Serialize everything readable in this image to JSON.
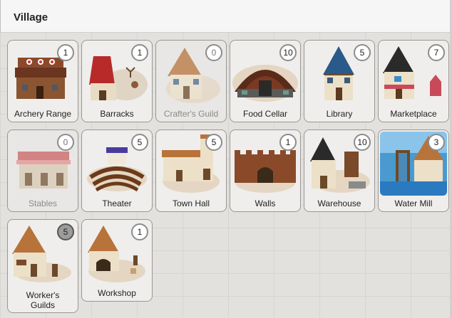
{
  "header": {
    "title": "Village"
  },
  "buildings": [
    {
      "name": "Archery Range",
      "count": "1"
    },
    {
      "name": "Barracks",
      "count": "1"
    },
    {
      "name": "Crafter's Guild",
      "count": "0"
    },
    {
      "name": "Food Cellar",
      "count": "10"
    },
    {
      "name": "Library",
      "count": "5"
    },
    {
      "name": "Marketplace",
      "count": "7"
    },
    {
      "name": "Stables",
      "count": "0"
    },
    {
      "name": "Theater",
      "count": "5"
    },
    {
      "name": "Town Hall",
      "count": "5"
    },
    {
      "name": "Walls",
      "count": "1"
    },
    {
      "name": "Warehouse",
      "count": "10"
    },
    {
      "name": "Water Mill",
      "count": "3"
    },
    {
      "name": "Worker's Guilds",
      "count": "5"
    },
    {
      "name": "Workshop",
      "count": "1"
    }
  ]
}
